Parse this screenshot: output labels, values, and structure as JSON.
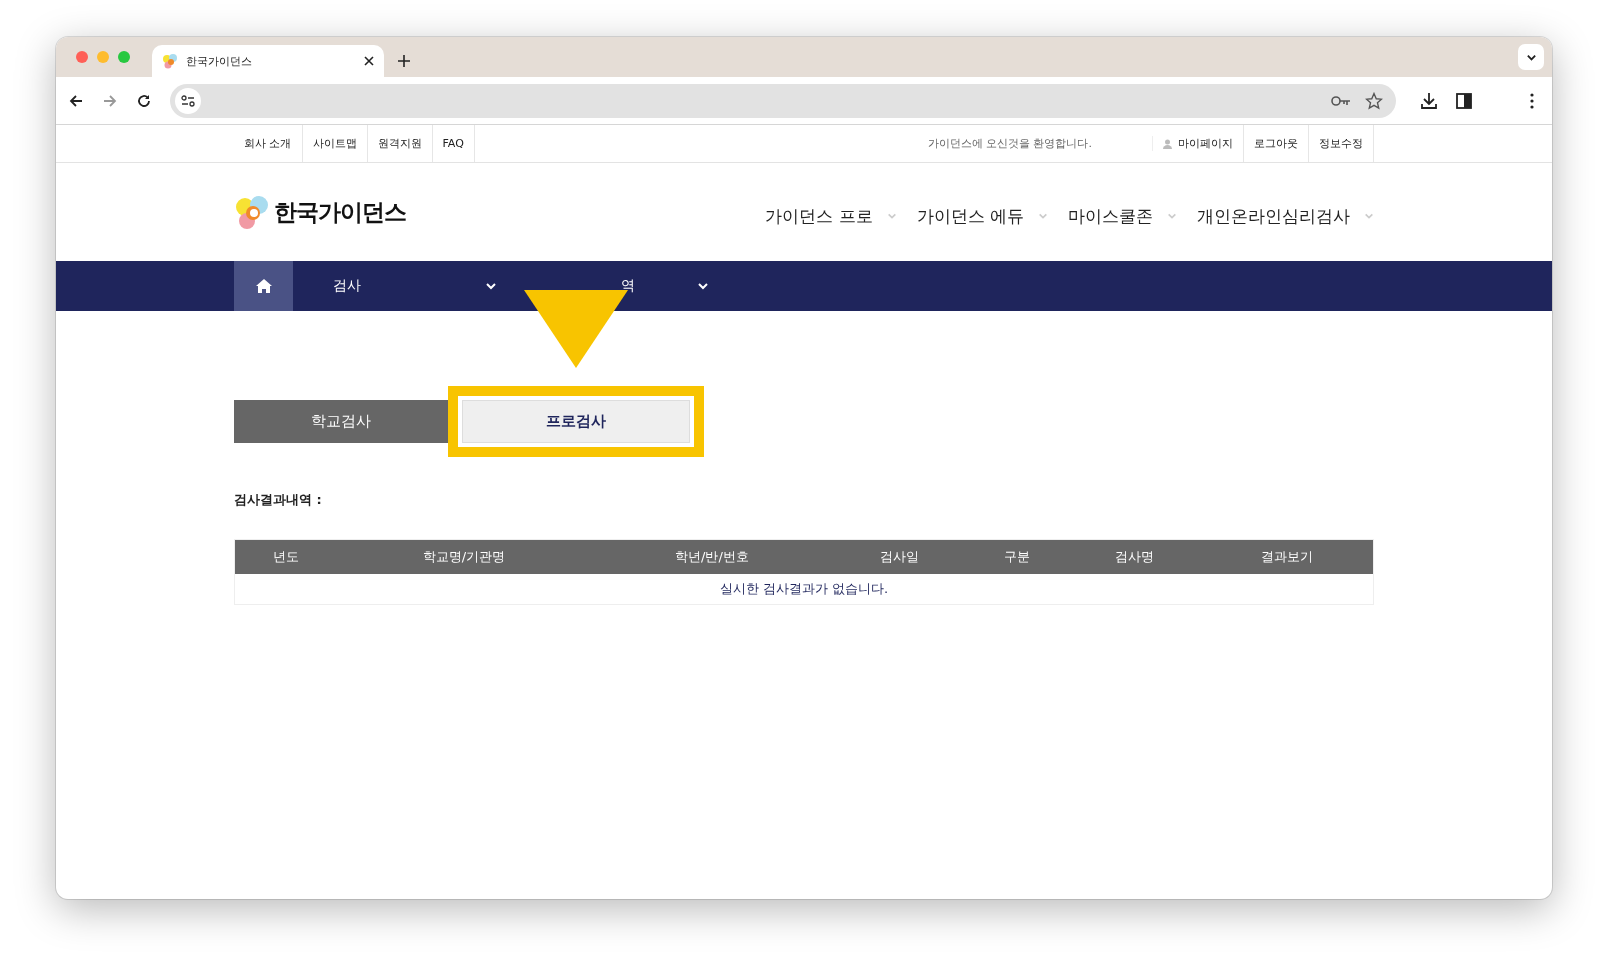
{
  "browser": {
    "tab_title": "한국가이던스"
  },
  "utility_bar": {
    "left_links": [
      "회사 소개",
      "사이트맵",
      "원격지원",
      "FAQ"
    ],
    "welcome": "가이던스에 오신것을 환영합니다.",
    "right_links": [
      "마이페이지",
      "로그아웃",
      "정보수정"
    ]
  },
  "header": {
    "logo_text": "한국가이던스",
    "nav": [
      "가이던스 프로",
      "가이던스 에듀",
      "마이스쿨존",
      "개인온라인심리검사"
    ]
  },
  "sub_nav": {
    "items": [
      "검사",
      "역"
    ]
  },
  "tabs": [
    {
      "label": "학교검사",
      "selected": false,
      "highlighted": false
    },
    {
      "label": "프로검사",
      "selected": true,
      "highlighted": true
    }
  ],
  "section_label": "검사결과내역 :",
  "table": {
    "columns": [
      "년도",
      "학교명/기관명",
      "학년/반/번호",
      "검사일",
      "구분",
      "검사명",
      "결과보기"
    ],
    "empty_message": "실시한 검사결과가 없습니다."
  }
}
